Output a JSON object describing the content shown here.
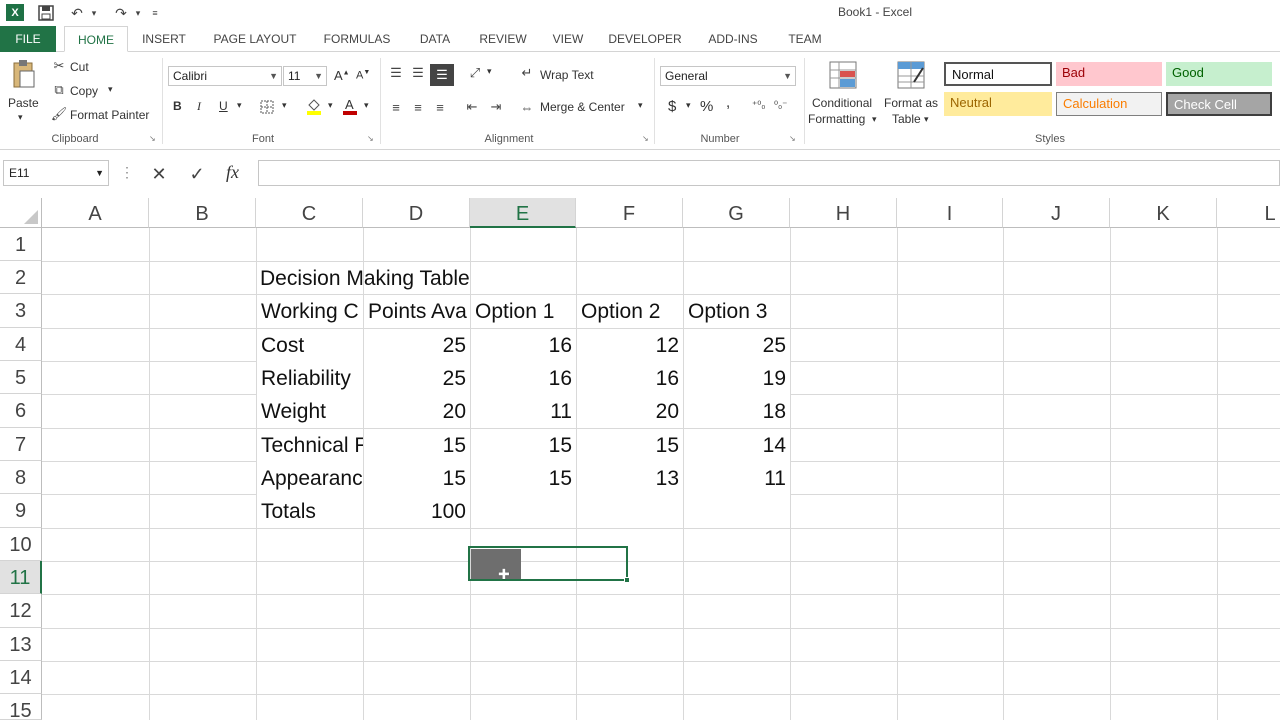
{
  "window": {
    "title": "Book1 - Excel"
  },
  "quick_access": {
    "save_icon": "save-icon",
    "undo_icon": "undo-icon",
    "redo_icon": "redo-icon",
    "customize_icon": "customize-icon"
  },
  "tabs": [
    "FILE",
    "HOME",
    "INSERT",
    "PAGE LAYOUT",
    "FORMULAS",
    "DATA",
    "REVIEW",
    "VIEW",
    "DEVELOPER",
    "ADD-INS",
    "TEAM"
  ],
  "ribbon": {
    "clipboard": {
      "paste": "Paste",
      "cut": "Cut",
      "copy": "Copy",
      "format_painter": "Format Painter",
      "label": "Clipboard"
    },
    "font": {
      "name": "Calibri",
      "size": "11",
      "bold": "B",
      "italic": "I",
      "underline": "U",
      "label": "Font"
    },
    "alignment": {
      "wrap_text": "Wrap Text",
      "merge_center": "Merge & Center",
      "label": "Alignment"
    },
    "number": {
      "format": "General",
      "currency": "$",
      "percent": "%",
      "comma": ",",
      "label": "Number"
    },
    "styles": {
      "conditional_formatting_1": "Conditional",
      "conditional_formatting_2": "Formatting",
      "format_as_table_1": "Format as",
      "format_as_table_2": "Table",
      "normal": "Normal",
      "bad": "Bad",
      "good": "Good",
      "neutral": "Neutral",
      "calculation": "Calculation",
      "check_cell": "Check Cell",
      "label": "Styles"
    }
  },
  "formula_bar": {
    "name_box": "E11",
    "fx": "fx",
    "content": ""
  },
  "columns": [
    "A",
    "B",
    "C",
    "D",
    "E",
    "F",
    "G",
    "H",
    "I",
    "J",
    "K",
    "L"
  ],
  "rows": [
    "1",
    "2",
    "3",
    "4",
    "5",
    "6",
    "7",
    "8",
    "9",
    "10",
    "11",
    "12",
    "13",
    "14",
    "15"
  ],
  "selected": {
    "column": "E",
    "row": "11"
  },
  "sheet": {
    "title": "Decision Making Table",
    "headers": [
      "Working C",
      "Points Ava",
      "Option 1",
      "Option 2",
      "Option 3"
    ],
    "rows": [
      {
        "label": "Cost",
        "points": "25",
        "opt1": "16",
        "opt2": "12",
        "opt3": "25"
      },
      {
        "label": "Reliability",
        "points": "25",
        "opt1": "16",
        "opt2": "16",
        "opt3": "19"
      },
      {
        "label": "Weight",
        "points": "20",
        "opt1": "11",
        "opt2": "20",
        "opt3": "18"
      },
      {
        "label": "Technical F",
        "points": "15",
        "opt1": "15",
        "opt2": "15",
        "opt3": "14"
      },
      {
        "label": "Appearanc",
        "points": "15",
        "opt1": "15",
        "opt2": "13",
        "opt3": "11"
      }
    ],
    "totals_label": "Totals",
    "totals_points": "100"
  },
  "colors": {
    "accent": "#217346",
    "bad_bg": "#ffc7ce",
    "good_bg": "#c6efce",
    "neutral_bg": "#ffeb9c",
    "check_bg": "#a5a5a5"
  }
}
